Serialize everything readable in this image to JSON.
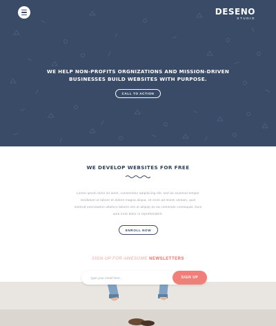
{
  "header": {
    "logo_main": "DESENO",
    "logo_sub": "STUDIO",
    "menu_icon": "hamburger-icon"
  },
  "hero": {
    "heading_line1": "WE HELP NON-PROFITS ORGNIZATIONS AND MISSION-DRIVEN",
    "heading_line2": "BUSINESSES BUILD WEBSITES WITH PURPOSE.",
    "cta_label": "CALL TO ACTION",
    "background_color": "#3a4b68"
  },
  "free_section": {
    "title": "WE DEVELOP WEBSITES FOR FREE",
    "divider_icon": "wave-divider-icon",
    "body_line1": "Lorem ipsum dolor sit amet, consectetur adipisicing elit, sed do eiusmod tempor",
    "body_line2": "incididunt ut labore et dolore magna aliqua. Ut enim ad minim veniam, quis",
    "body_line3": "nostrud exercitation ullamco laboris nisi ut aliquip ex ea commodo consequat. Duis",
    "body_line4": "aute irure dolor in reprehenderit.",
    "enroll_label": "ENROLL NOW"
  },
  "newsletter": {
    "title_light": "SIGN UP FOR AWESOME",
    "title_strong": "NEWSLETTERS",
    "email_placeholder": "type your email here...",
    "signup_label": "SIGN UP",
    "accent_color": "#f07f79"
  }
}
